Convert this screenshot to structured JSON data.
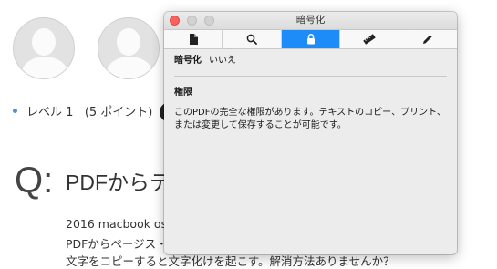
{
  "page": {
    "level_text": "レベル 1",
    "points_text": "(5 ポイント)",
    "q_letter": "Q:",
    "q_title": "PDFからテキ",
    "q_line1": "2016 macbook os",
    "q_line2": "PDFからページス・テ",
    "q_line3": "文字をコピーすると文字化けを起こす。解消方法ありませんか？"
  },
  "panel": {
    "title": "暗号化",
    "tabs": [
      {
        "icon": "document-icon",
        "active": false
      },
      {
        "icon": "search-icon",
        "active": false
      },
      {
        "icon": "lock-icon",
        "active": true
      },
      {
        "icon": "ruler-icon",
        "active": false
      },
      {
        "icon": "pencil-icon",
        "active": false
      }
    ],
    "encryption_label": "暗号化",
    "encryption_value": "いいえ",
    "permissions_heading": "権限",
    "permissions_text": "このPDFの完全な権限があります。テキストのコピー、プリント、または変更して保存することが可能です。"
  },
  "colors": {
    "active_tab": "#1d8cf8",
    "close_button": "#fc605c",
    "bullet": "#4a90e2"
  }
}
